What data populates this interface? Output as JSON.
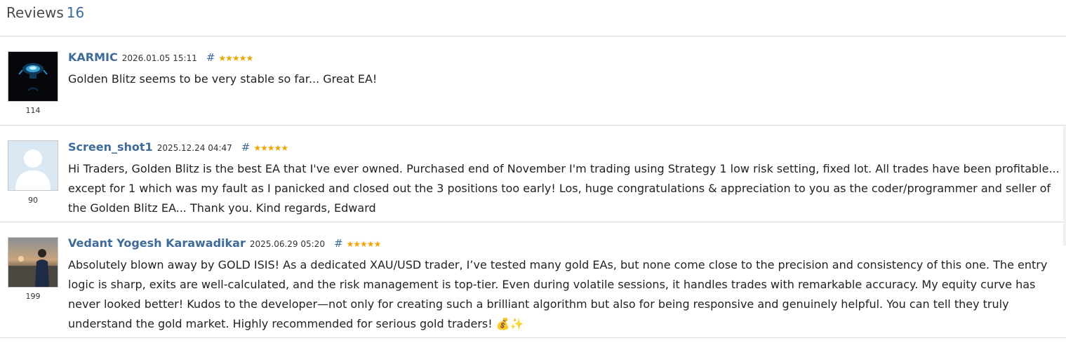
{
  "header": {
    "title": "Reviews",
    "count": "16"
  },
  "reviews": [
    {
      "author": "KARMIC",
      "date": "2026.01.05 15:11",
      "hash": "#",
      "stars": "★★★★★",
      "rating_value": 5,
      "avatar_rating": "114",
      "text": "Golden Blitz seems to be very stable so far... Great EA!"
    },
    {
      "author": "Screen_shot1",
      "date": "2025.12.24 04:47",
      "hash": "#",
      "stars": "★★★★★",
      "rating_value": 5,
      "avatar_rating": "90",
      "text": "Hi Traders, Golden Blitz is the best EA that I've ever owned. Purchased end of November I'm trading using Strategy 1 low risk setting, fixed lot. All trades have been profitable... except for 1 which was my fault as I panicked and closed out the 3 positions too early! Los, huge congratulations & appreciation to you as the coder/programmer and seller of the Golden Blitz EA... Thank you. Kind regards, Edward"
    },
    {
      "author": "Vedant Yogesh Karawadikar",
      "date": "2025.06.29 05:20",
      "hash": "#",
      "stars": "★★★★★",
      "rating_value": 5,
      "avatar_rating": "199",
      "text": "Absolutely blown away by GOLD ISIS! As a dedicated XAU/USD trader, I’ve tested many gold EAs, but none come close to the precision and consistency of this one. The entry logic is sharp, exits are well-calculated, and the risk management is top-tier. Even during volatile sessions, it handles trades with remarkable accuracy. My equity curve has never looked better! Kudos to the developer—not only for creating such a brilliant algorithm but also for being responsive and genuinely helpful. You can tell they truly understand the gold market. Highly recommended for serious gold traders! 💰✨"
    }
  ]
}
